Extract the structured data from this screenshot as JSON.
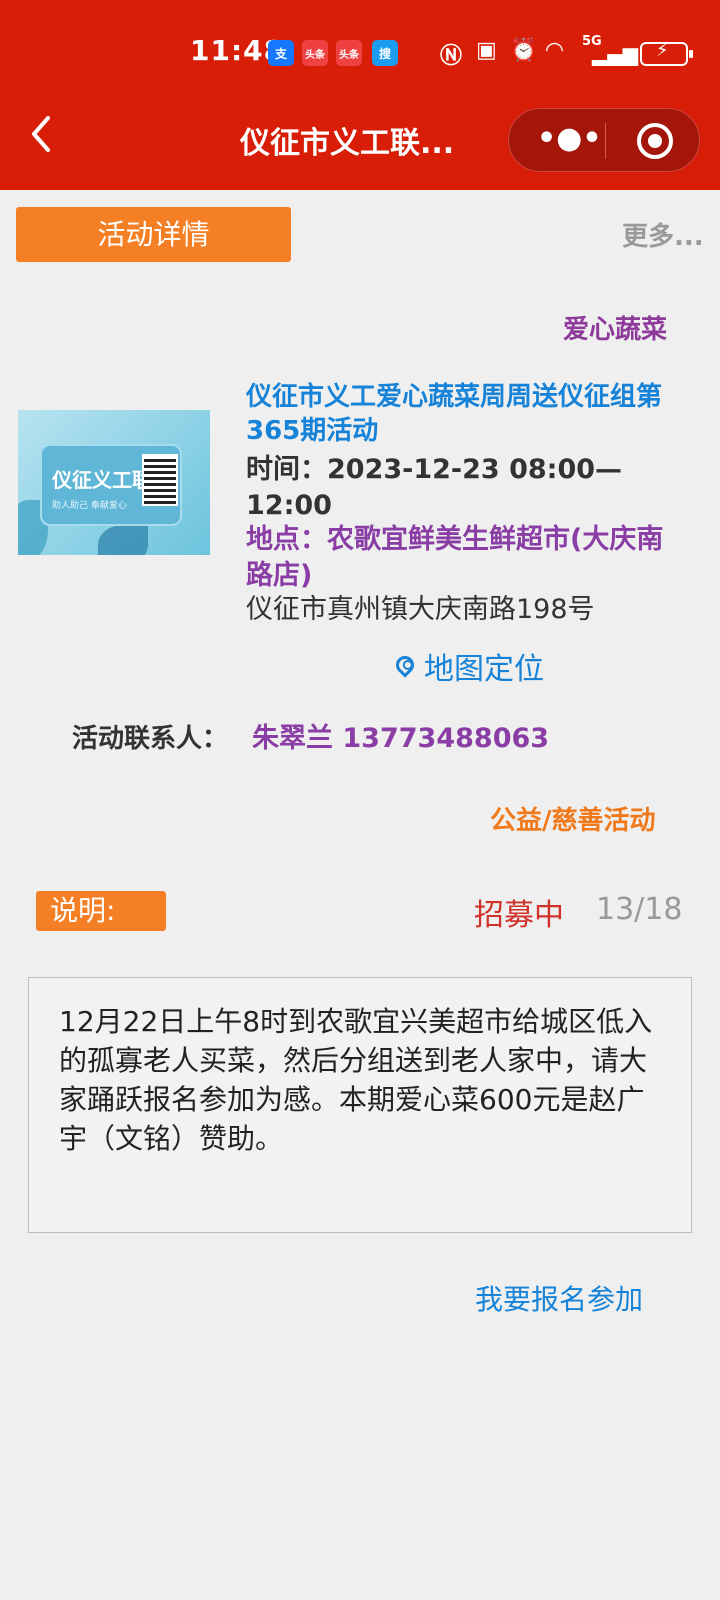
{
  "status_bar": {
    "time": "11:48",
    "app_icons": [
      "支",
      "头条",
      "头条",
      "搜"
    ],
    "signal": "5G",
    "icons": [
      "nfc-icon",
      "alarm-icon",
      "wifi-icon",
      "signal-icon",
      "battery-charging-icon"
    ]
  },
  "nav": {
    "title": "仪征市义工联...",
    "back_icon": "chevron-left-icon",
    "more_icon": "more-dots",
    "close_icon": "target-icon"
  },
  "header": {
    "tab_label": "活动详情",
    "more_label": "更多..."
  },
  "activity": {
    "category": "爱心蔬菜",
    "thumbnail_text": "仪征义工联",
    "thumbnail_subtext": "助人助己  奉献爱心",
    "title": "仪征市义工爱心蔬菜周周送仪征组第365期活动",
    "time": "时间：2023-12-23 08:00—12:00",
    "place": "地点：农歌宜鲜美生鲜超市(大庆南路店)",
    "address": "仪征市真州镇大庆南路198号",
    "map_label": "地图定位",
    "contact_label": "活动联系人：",
    "contact_value": "朱翠兰 13773488063",
    "type": "公益/慈善活动"
  },
  "description": {
    "tag": "说明:",
    "status": "招募中",
    "count": "13/18",
    "text": "12月22日上午8时到农歌宜兴美超市给城区低入的孤寡老人买菜，然后分组送到老人家中，请大家踊跃报名参加为感。本期爱心菜600元是赵广宇（文铭）赞助。"
  },
  "signup_label": "我要报名参加",
  "colors": {
    "brand_red": "#d81e06",
    "accent_orange": "#f47f25",
    "link_blue": "#1683d8",
    "purple": "#8a3ea5"
  }
}
